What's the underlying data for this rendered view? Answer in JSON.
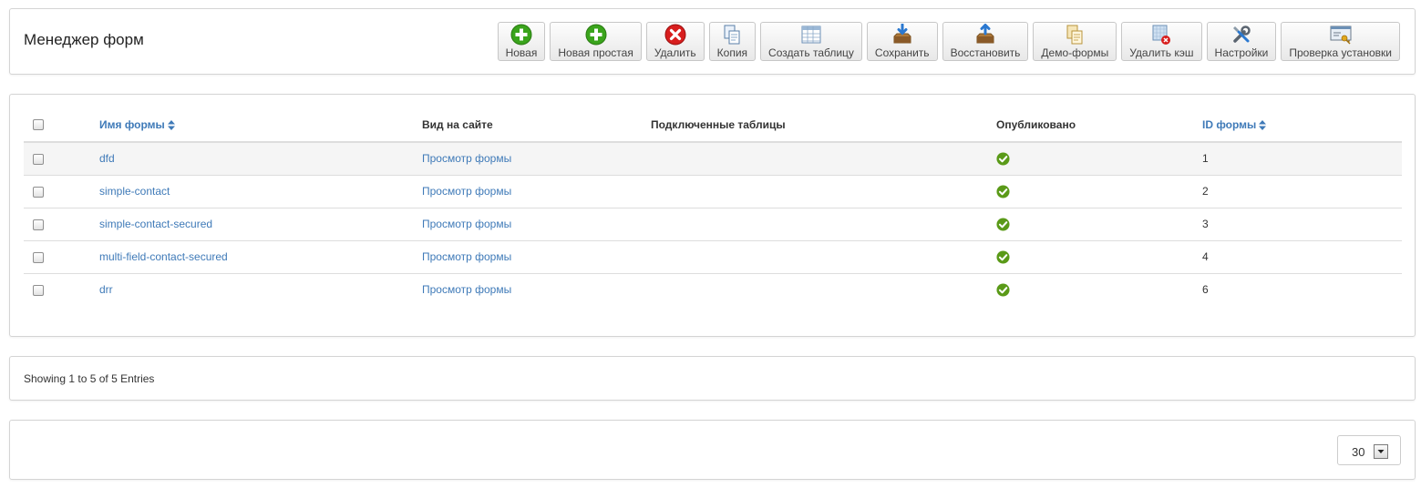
{
  "header": {
    "title": "Менеджер форм",
    "buttons": [
      {
        "key": "new",
        "label": "Новая",
        "icon": "plus-green-icon"
      },
      {
        "key": "new-simple",
        "label": "Новая простая",
        "icon": "plus-green-icon"
      },
      {
        "key": "delete",
        "label": "Удалить",
        "icon": "delete-red-icon"
      },
      {
        "key": "copy",
        "label": "Копия",
        "icon": "copy-icon"
      },
      {
        "key": "create-table",
        "label": "Создать таблицу",
        "icon": "table-icon"
      },
      {
        "key": "save",
        "label": "Сохранить",
        "icon": "save-download-icon"
      },
      {
        "key": "restore",
        "label": "Восстановить",
        "icon": "restore-upload-icon"
      },
      {
        "key": "demo-forms",
        "label": "Демо-формы",
        "icon": "demo-forms-icon"
      },
      {
        "key": "clear-cache",
        "label": "Удалить кэш",
        "icon": "clear-cache-icon"
      },
      {
        "key": "settings",
        "label": "Настройки",
        "icon": "tools-icon"
      },
      {
        "key": "check-install",
        "label": "Проверка установки",
        "icon": "check-install-icon"
      }
    ]
  },
  "table": {
    "columns": {
      "name": "Имя формы",
      "view": "Вид на сайте",
      "tables": "Подключенные таблицы",
      "published": "Опубликовано",
      "id": "ID формы"
    },
    "rows": [
      {
        "name": "dfd",
        "view": "Просмотр формы",
        "tables": "",
        "published": true,
        "id": "1"
      },
      {
        "name": "simple-contact",
        "view": "Просмотр формы",
        "tables": "",
        "published": true,
        "id": "2"
      },
      {
        "name": "simple-contact-secured",
        "view": "Просмотр формы",
        "tables": "",
        "published": true,
        "id": "3"
      },
      {
        "name": "multi-field-contact-secured",
        "view": "Просмотр формы",
        "tables": "",
        "published": true,
        "id": "4"
      },
      {
        "name": "drr",
        "view": "Просмотр формы",
        "tables": "",
        "published": true,
        "id": "6"
      }
    ]
  },
  "info": {
    "text": "Showing 1 to 5 of 5 Entries"
  },
  "pager": {
    "limit": "30"
  },
  "colors": {
    "link": "#3f7ab8",
    "published": "#5a9a18",
    "border": "#d4d4d4",
    "row_alt": "#f5f5f5"
  }
}
